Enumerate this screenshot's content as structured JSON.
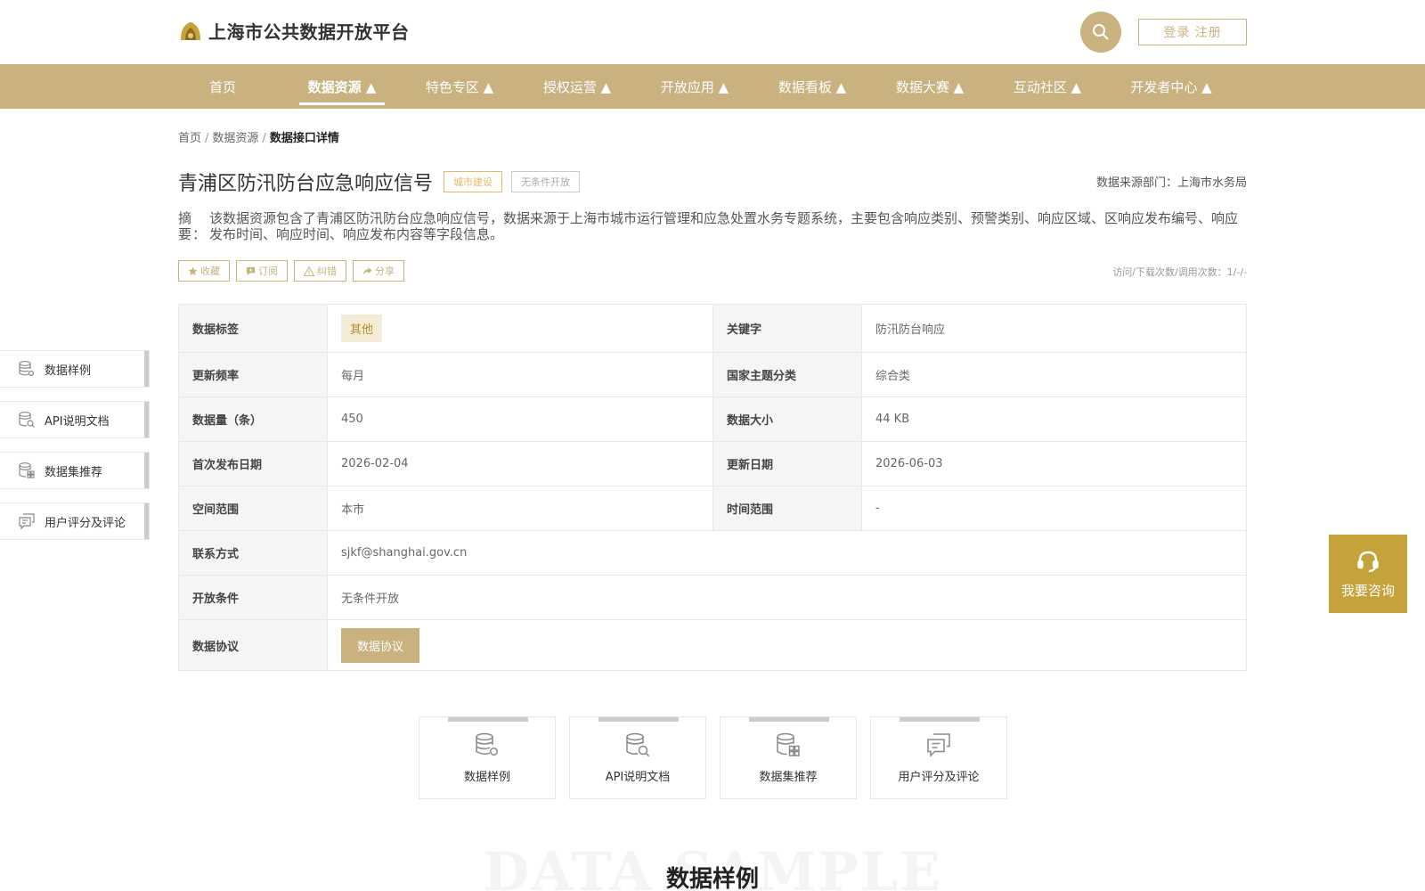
{
  "header": {
    "title": "上海市公共数据开放平台",
    "login_label": "登录 注册"
  },
  "nav": [
    {
      "label": "首页"
    },
    {
      "label": "数据资源 ▲",
      "active": true
    },
    {
      "label": "特色专区 ▲"
    },
    {
      "label": "授权运营 ▲"
    },
    {
      "label": "开放应用 ▲"
    },
    {
      "label": "数据看板 ▲"
    },
    {
      "label": "数据大赛 ▲"
    },
    {
      "label": "互动社区 ▲"
    },
    {
      "label": "开发者中心 ▲"
    }
  ],
  "breadcrumb": {
    "home": "首页",
    "sep": "/",
    "resources": "数据资源",
    "current": "数据接口详情"
  },
  "dataset": {
    "title": "青浦区防汛防台应急响应信号",
    "tags": [
      "城市建设",
      "无条件开放"
    ],
    "source": "数据来源部门：上海市水务局",
    "abstract_label": "摘要：",
    "abstract": "该数据资源包含了青浦区防汛防台应急响应信号，数据来源于上海市城市运行管理和应急处置水务专题系统，主要包含响应类别、预警类别、响应区域、区响应发布编号、响应发布时间、响应时间、响应发布内容等字段信息。"
  },
  "actions": {
    "favorite": "收藏",
    "subscribe": "订阅",
    "correct": "纠错",
    "share": "分享",
    "counts": "访问/下载次数/调用次数：1/-/-"
  },
  "info": {
    "label_tag": "数据标签",
    "tag_value": "其他",
    "label_keyword": "关键字",
    "keyword": "防汛防台响应",
    "label_freq": "更新频率",
    "freq": "每月",
    "label_theme": "国家主题分类",
    "theme": "综合类",
    "label_count": "数据量（条）",
    "count": "450",
    "label_size": "数据大小",
    "size": "44 KB",
    "label_first": "首次发布日期",
    "first": "2026-02-04",
    "label_updated": "更新日期",
    "updated": "2026-06-03",
    "label_space": "空间范围",
    "space": "本市",
    "label_time": "时间范围",
    "time": "-",
    "label_contact": "联系方式",
    "contact": "sjkf@shanghai.gov.cn",
    "label_cond": "开放条件",
    "cond": "无条件开放",
    "label_agree": "数据协议",
    "agree_btn": "数据协议"
  },
  "side_nav": [
    "数据样例",
    "API说明文档",
    "数据集推荐",
    "用户评分及评论"
  ],
  "consult_label": "我要咨询",
  "tabs": [
    "数据样例",
    "API说明文档",
    "数据集推荐",
    "用户评分及评论"
  ],
  "section": {
    "bg": "DATA SAMPLE",
    "title": "数据样例"
  },
  "colors": {
    "brand": "#c9b27f",
    "consult": "#c4a43a",
    "tag": "#e6b865"
  }
}
